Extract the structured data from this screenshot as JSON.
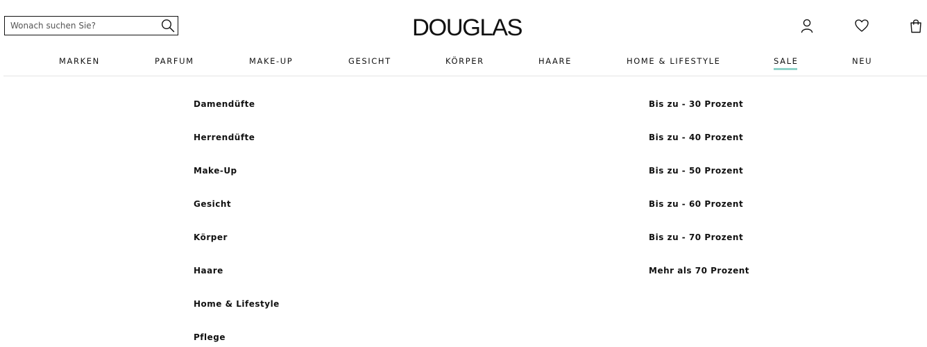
{
  "search": {
    "placeholder": "Wonach suchen Sie?",
    "value": ""
  },
  "logo": {
    "text": "DOUGLAS"
  },
  "header_icons": [
    {
      "name": "account-icon"
    },
    {
      "name": "wishlist-heart-icon"
    },
    {
      "name": "shopping-bag-icon"
    }
  ],
  "nav": {
    "items": [
      {
        "label": "MARKEN"
      },
      {
        "label": "PARFUM"
      },
      {
        "label": "MAKE-UP"
      },
      {
        "label": "GESICHT"
      },
      {
        "label": "KÖRPER"
      },
      {
        "label": "HAARE"
      },
      {
        "label": "HOME & LIFESTYLE"
      },
      {
        "label": "SALE",
        "active": true
      },
      {
        "label": "NEU"
      }
    ],
    "active_underline_color": "#8ed2c8"
  },
  "sale_menu": {
    "categories": [
      "Damendüfte",
      "Herrendüfte",
      "Make-Up",
      "Gesicht",
      "Körper",
      "Haare",
      "Home & Lifestyle",
      "Pflege"
    ],
    "discounts": [
      "Bis zu - 30 Prozent",
      "Bis zu - 40 Prozent",
      "Bis zu - 50 Prozent",
      "Bis zu - 60 Prozent",
      "Bis zu - 70 Prozent",
      "Mehr als 70 Prozent"
    ]
  }
}
